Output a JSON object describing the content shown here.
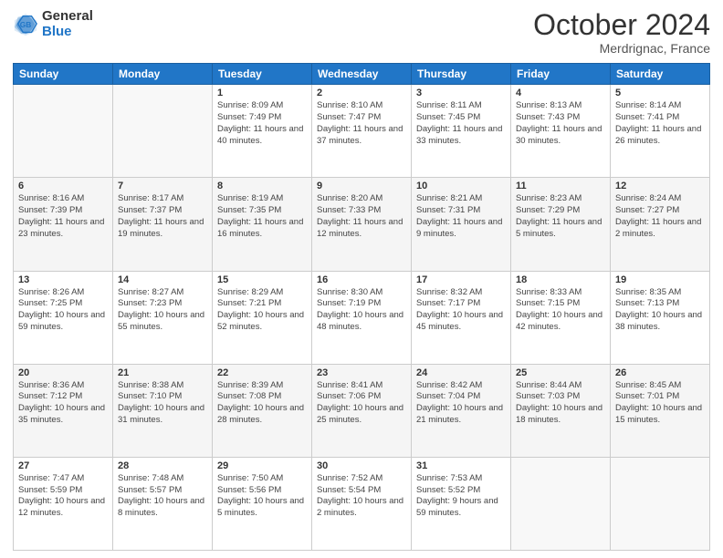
{
  "header": {
    "logo_general": "General",
    "logo_blue": "Blue",
    "month": "October 2024",
    "location": "Merdrignac, France"
  },
  "days_of_week": [
    "Sunday",
    "Monday",
    "Tuesday",
    "Wednesday",
    "Thursday",
    "Friday",
    "Saturday"
  ],
  "weeks": [
    [
      {
        "day": "",
        "info": ""
      },
      {
        "day": "",
        "info": ""
      },
      {
        "day": "1",
        "sunrise": "8:09 AM",
        "sunset": "7:49 PM",
        "daylight": "11 hours and 40 minutes."
      },
      {
        "day": "2",
        "sunrise": "8:10 AM",
        "sunset": "7:47 PM",
        "daylight": "11 hours and 37 minutes."
      },
      {
        "day": "3",
        "sunrise": "8:11 AM",
        "sunset": "7:45 PM",
        "daylight": "11 hours and 33 minutes."
      },
      {
        "day": "4",
        "sunrise": "8:13 AM",
        "sunset": "7:43 PM",
        "daylight": "11 hours and 30 minutes."
      },
      {
        "day": "5",
        "sunrise": "8:14 AM",
        "sunset": "7:41 PM",
        "daylight": "11 hours and 26 minutes."
      }
    ],
    [
      {
        "day": "6",
        "sunrise": "8:16 AM",
        "sunset": "7:39 PM",
        "daylight": "11 hours and 23 minutes."
      },
      {
        "day": "7",
        "sunrise": "8:17 AM",
        "sunset": "7:37 PM",
        "daylight": "11 hours and 19 minutes."
      },
      {
        "day": "8",
        "sunrise": "8:19 AM",
        "sunset": "7:35 PM",
        "daylight": "11 hours and 16 minutes."
      },
      {
        "day": "9",
        "sunrise": "8:20 AM",
        "sunset": "7:33 PM",
        "daylight": "11 hours and 12 minutes."
      },
      {
        "day": "10",
        "sunrise": "8:21 AM",
        "sunset": "7:31 PM",
        "daylight": "11 hours and 9 minutes."
      },
      {
        "day": "11",
        "sunrise": "8:23 AM",
        "sunset": "7:29 PM",
        "daylight": "11 hours and 5 minutes."
      },
      {
        "day": "12",
        "sunrise": "8:24 AM",
        "sunset": "7:27 PM",
        "daylight": "11 hours and 2 minutes."
      }
    ],
    [
      {
        "day": "13",
        "sunrise": "8:26 AM",
        "sunset": "7:25 PM",
        "daylight": "10 hours and 59 minutes."
      },
      {
        "day": "14",
        "sunrise": "8:27 AM",
        "sunset": "7:23 PM",
        "daylight": "10 hours and 55 minutes."
      },
      {
        "day": "15",
        "sunrise": "8:29 AM",
        "sunset": "7:21 PM",
        "daylight": "10 hours and 52 minutes."
      },
      {
        "day": "16",
        "sunrise": "8:30 AM",
        "sunset": "7:19 PM",
        "daylight": "10 hours and 48 minutes."
      },
      {
        "day": "17",
        "sunrise": "8:32 AM",
        "sunset": "7:17 PM",
        "daylight": "10 hours and 45 minutes."
      },
      {
        "day": "18",
        "sunrise": "8:33 AM",
        "sunset": "7:15 PM",
        "daylight": "10 hours and 42 minutes."
      },
      {
        "day": "19",
        "sunrise": "8:35 AM",
        "sunset": "7:13 PM",
        "daylight": "10 hours and 38 minutes."
      }
    ],
    [
      {
        "day": "20",
        "sunrise": "8:36 AM",
        "sunset": "7:12 PM",
        "daylight": "10 hours and 35 minutes."
      },
      {
        "day": "21",
        "sunrise": "8:38 AM",
        "sunset": "7:10 PM",
        "daylight": "10 hours and 31 minutes."
      },
      {
        "day": "22",
        "sunrise": "8:39 AM",
        "sunset": "7:08 PM",
        "daylight": "10 hours and 28 minutes."
      },
      {
        "day": "23",
        "sunrise": "8:41 AM",
        "sunset": "7:06 PM",
        "daylight": "10 hours and 25 minutes."
      },
      {
        "day": "24",
        "sunrise": "8:42 AM",
        "sunset": "7:04 PM",
        "daylight": "10 hours and 21 minutes."
      },
      {
        "day": "25",
        "sunrise": "8:44 AM",
        "sunset": "7:03 PM",
        "daylight": "10 hours and 18 minutes."
      },
      {
        "day": "26",
        "sunrise": "8:45 AM",
        "sunset": "7:01 PM",
        "daylight": "10 hours and 15 minutes."
      }
    ],
    [
      {
        "day": "27",
        "sunrise": "7:47 AM",
        "sunset": "5:59 PM",
        "daylight": "10 hours and 12 minutes."
      },
      {
        "day": "28",
        "sunrise": "7:48 AM",
        "sunset": "5:57 PM",
        "daylight": "10 hours and 8 minutes."
      },
      {
        "day": "29",
        "sunrise": "7:50 AM",
        "sunset": "5:56 PM",
        "daylight": "10 hours and 5 minutes."
      },
      {
        "day": "30",
        "sunrise": "7:52 AM",
        "sunset": "5:54 PM",
        "daylight": "10 hours and 2 minutes."
      },
      {
        "day": "31",
        "sunrise": "7:53 AM",
        "sunset": "5:52 PM",
        "daylight": "9 hours and 59 minutes."
      },
      {
        "day": "",
        "info": ""
      },
      {
        "day": "",
        "info": ""
      }
    ]
  ],
  "labels": {
    "sunrise": "Sunrise:",
    "sunset": "Sunset:",
    "daylight": "Daylight:"
  }
}
